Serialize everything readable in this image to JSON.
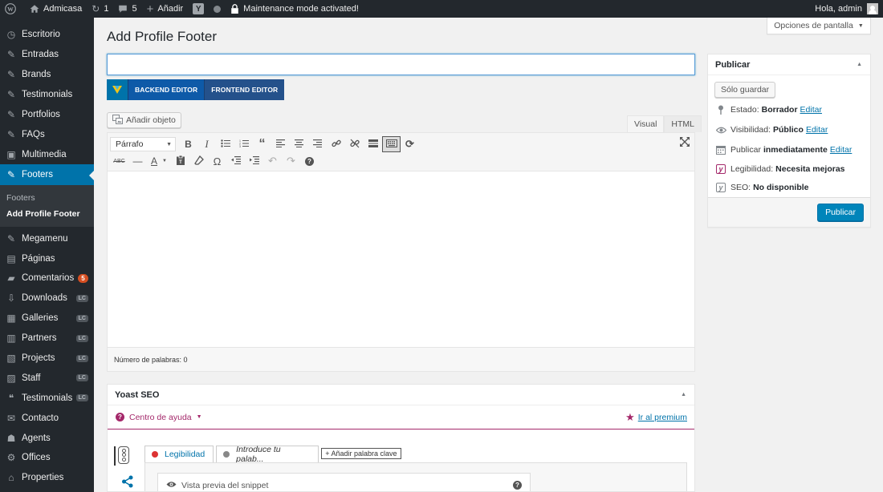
{
  "adminbar": {
    "site_name": "Admicasa",
    "updates_count": "1",
    "comments_count": "5",
    "new_label": "Añadir",
    "maintenance": "Maintenance mode activated!",
    "greeting": "Hola, admin"
  },
  "menu": {
    "items_top": [
      {
        "label": "Escritorio",
        "icon": "dashboard-icon"
      },
      {
        "label": "Entradas",
        "icon": "pin-icon"
      },
      {
        "label": "Brands",
        "icon": "pin-icon"
      },
      {
        "label": "Testimonials",
        "icon": "pin-icon"
      },
      {
        "label": "Portfolios",
        "icon": "pin-icon"
      },
      {
        "label": "FAQs",
        "icon": "pin-icon"
      },
      {
        "label": "Multimedia",
        "icon": "media-icon"
      },
      {
        "label": "Footers",
        "icon": "pin-icon"
      }
    ],
    "submenu": [
      "Footers",
      "Add Profile Footer"
    ],
    "items_bottom": [
      {
        "label": "Megamenu",
        "icon": "pin-icon"
      },
      {
        "label": "Páginas",
        "icon": "page-icon"
      },
      {
        "label": "Comentarios",
        "icon": "comment-icon",
        "badge": "5"
      },
      {
        "label": "Downloads",
        "icon": "download-icon",
        "tag": "LC"
      },
      {
        "label": "Galleries",
        "icon": "gallery-icon",
        "tag": "LC"
      },
      {
        "label": "Partners",
        "icon": "partners-icon",
        "tag": "LC"
      },
      {
        "label": "Projects",
        "icon": "projects-icon",
        "tag": "LC"
      },
      {
        "label": "Staff",
        "icon": "staff-icon",
        "tag": "LC"
      },
      {
        "label": "Testimonials",
        "icon": "quote-icon",
        "tag": "LC"
      },
      {
        "label": "Contacto",
        "icon": "mail-icon"
      },
      {
        "label": "Agents",
        "icon": "agents-icon"
      },
      {
        "label": "Offices",
        "icon": "offices-icon"
      },
      {
        "label": "Properties",
        "icon": "properties-icon"
      }
    ]
  },
  "screen_options": "Opciones de pantalla",
  "page_title": "Add Profile Footer",
  "title_input": {
    "value": "",
    "placeholder": ""
  },
  "composer": {
    "backend": "BACKEND EDITOR",
    "frontend": "FRONTEND EDITOR"
  },
  "add_media": "Añadir objeto",
  "editor_tabs": {
    "visual": "Visual",
    "html": "HTML"
  },
  "format_select": "Párrafo",
  "word_count": "Número de palabras: 0",
  "publish": {
    "title": "Publicar",
    "save_draft": "Sólo guardar",
    "status_label": "Estado:",
    "status_value": "Borrador",
    "visibility_label": "Visibilidad:",
    "visibility_value": "Público",
    "publish_label": "Publicar",
    "publish_value": "inmediatamente",
    "readability_label": "Legibilidad:",
    "readability_value": "Necesita mejoras",
    "seo_label": "SEO:",
    "seo_value": "No disponible",
    "edit_link": "Editar",
    "publish_button": "Publicar"
  },
  "yoast": {
    "title": "Yoast SEO",
    "help_center": "Centro de ayuda",
    "premium": "Ir al premium",
    "tab_readability": "Legibilidad",
    "tab_keyword": "Introduce tu palab...",
    "add_keyword": "+ Añadir palabra clave",
    "snippet_preview": "Vista previa del snippet"
  },
  "colors": {
    "accent": "#0073aa",
    "yoast": "#a4286a",
    "menu_bg": "#23282d"
  }
}
